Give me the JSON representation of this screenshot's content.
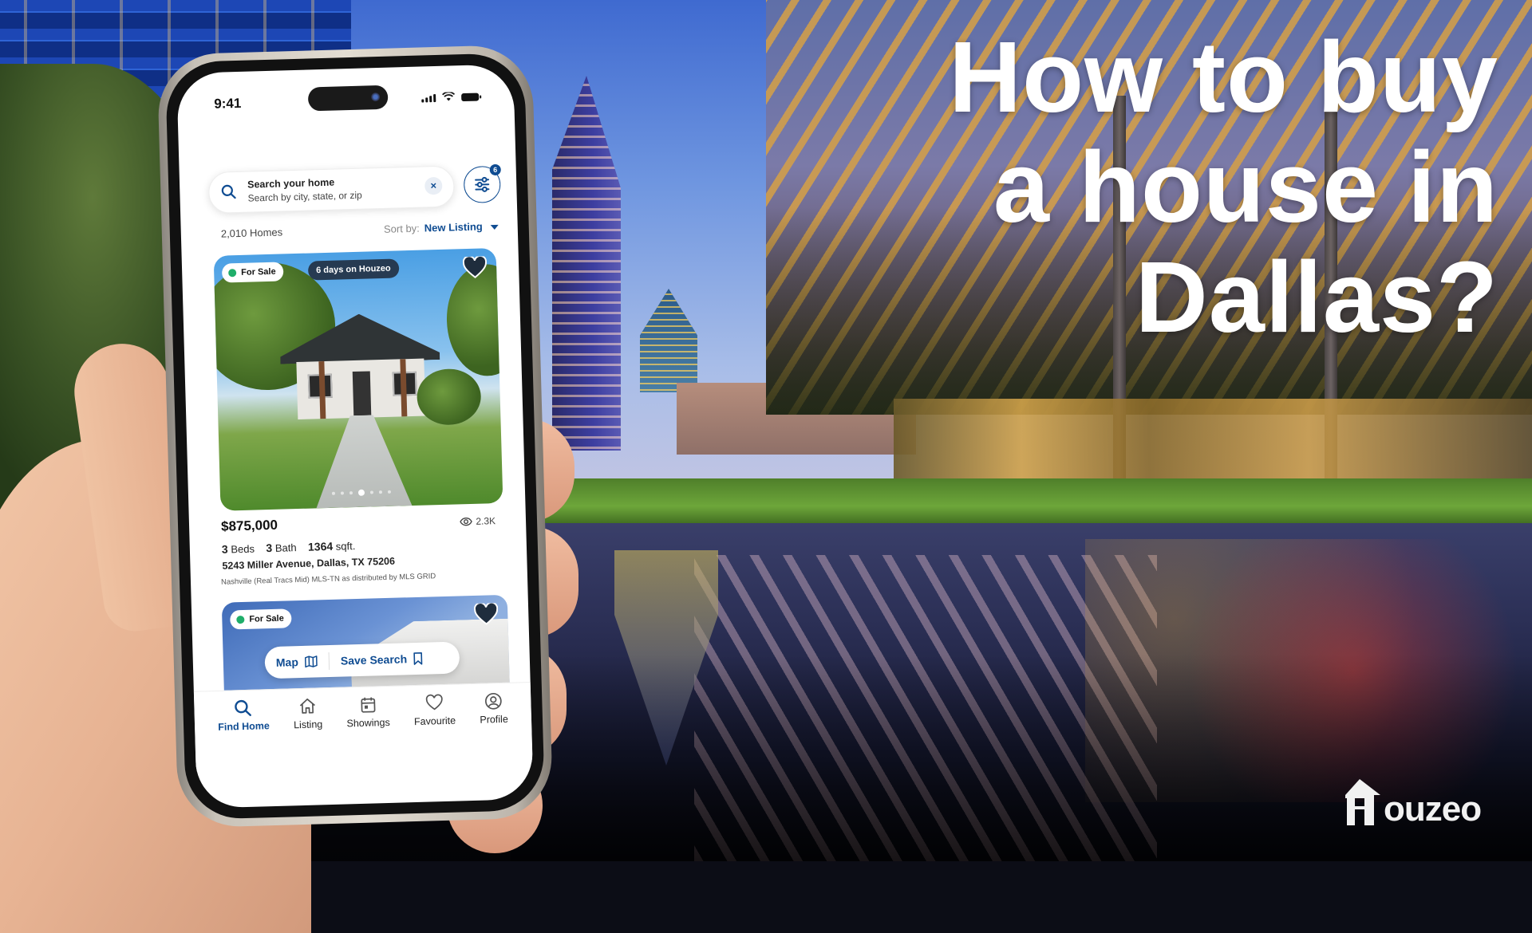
{
  "headline": {
    "lines": [
      "How to buy",
      "a house in",
      "Dallas?"
    ]
  },
  "brand": {
    "logo_text": "ouzeo",
    "logo_letter": "H",
    "name": "Houzeo"
  },
  "phone": {
    "status_bar": {
      "time": "9:41",
      "icons": [
        "signal-icon",
        "wifi-icon",
        "battery-icon"
      ]
    },
    "search": {
      "title": "Search your home",
      "placeholder": "Search by city, state, or zip",
      "clear_icon": "×",
      "filter_badge": "6"
    },
    "results": {
      "count": "2,010 Homes",
      "sort_label": "Sort by:",
      "sort_value": "New Listing"
    },
    "listings": [
      {
        "status": "For Sale",
        "days_on_site": "6  days on Houzeo",
        "price": "$875,000",
        "views": "2.3K",
        "beds_num": "3",
        "beds_label": "Beds",
        "baths_num": "3",
        "baths_label": "Bath",
        "sqft_num": "1364",
        "sqft_label": "sqft.",
        "address": "5243 Miller Avenue, Dallas, TX 75206",
        "mls_note": "Nashville (Real Tracs Mid) MLS-TN as distributed by MLS GRID",
        "carousel_total": 7,
        "carousel_active": 4
      },
      {
        "status": "For Sale"
      }
    ],
    "float_actions": {
      "map_label": "Map",
      "save_search_label": "Save Search"
    },
    "tabs": [
      {
        "label": "Find Home",
        "icon": "search-icon",
        "active": true
      },
      {
        "label": "Listing",
        "icon": "home-icon",
        "active": false
      },
      {
        "label": "Showings",
        "icon": "calendar-icon",
        "active": false
      },
      {
        "label": "Favourite",
        "icon": "heart-icon",
        "active": false
      },
      {
        "label": "Profile",
        "icon": "profile-icon",
        "active": false
      }
    ]
  },
  "colors": {
    "brand_blue": "#0f4c92",
    "status_green": "#1fae6a",
    "title_text": "#ffffff"
  }
}
